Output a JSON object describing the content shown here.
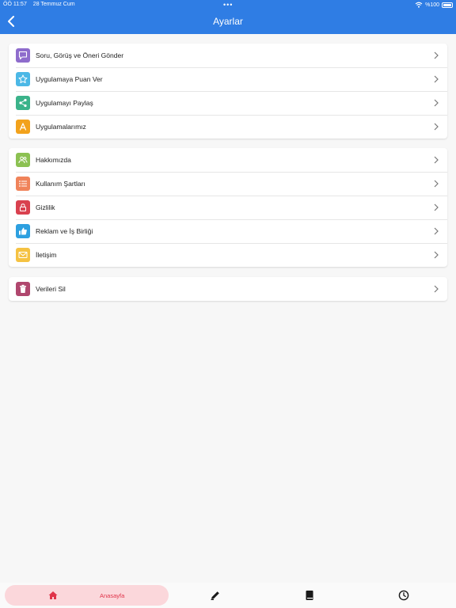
{
  "status": {
    "time": "ÖÖ 11:57",
    "date": "28 Temmuz Cum",
    "dots": "•••",
    "battery_text": "%100"
  },
  "header": {
    "title": "Ayarlar"
  },
  "groups": [
    {
      "items": [
        {
          "label": "Soru, Görüş ve Öneri Gönder",
          "icon": "chat-icon",
          "color": "#8e6ccc"
        },
        {
          "label": "Uygulamaya Puan Ver",
          "icon": "star-icon",
          "color": "#4cb8e6"
        },
        {
          "label": "Uygulamayı Paylaş",
          "icon": "share-icon",
          "color": "#3bb38a"
        },
        {
          "label": "Uygulamalarımız",
          "icon": "app-store-icon",
          "color": "#f2a21c"
        }
      ]
    },
    {
      "items": [
        {
          "label": "Hakkımızda",
          "icon": "people-icon",
          "color": "#8cc152"
        },
        {
          "label": "Kullanım Şartları",
          "icon": "list-icon",
          "color": "#f0835a"
        },
        {
          "label": "Gizlilik",
          "icon": "lock-icon",
          "color": "#d9414f"
        },
        {
          "label": "Reklam ve İş Birliği",
          "icon": "thumbs-up-icon",
          "color": "#2da0e0"
        },
        {
          "label": "İletişim",
          "icon": "mail-icon",
          "color": "#f5c242"
        }
      ]
    },
    {
      "items": [
        {
          "label": "Verileri Sil",
          "icon": "trash-icon",
          "color": "#b0476e"
        }
      ]
    }
  ],
  "tabbar": {
    "home_label": "Anasayfa",
    "active_color": "#e0344a"
  }
}
